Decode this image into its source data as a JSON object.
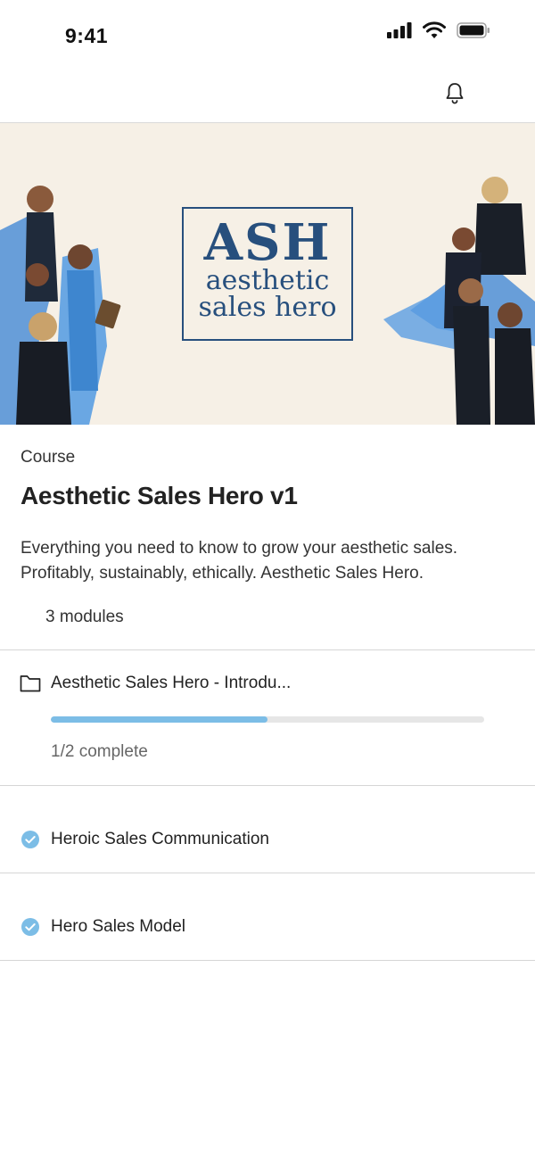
{
  "status_bar": {
    "time": "9:41"
  },
  "hero": {
    "logo_monogram": "ASH",
    "logo_line1": "aesthetic",
    "logo_line2": "sales hero"
  },
  "course": {
    "label": "Course",
    "title": "Aesthetic Sales Hero v1",
    "description": "Everything you need to know to grow your aesthetic sales. Profitably, sustainably, ethically. Aesthetic Sales Hero.",
    "modules_count": "3 modules"
  },
  "modules": [
    {
      "title": "Aesthetic Sales Hero - Introdu...",
      "icon": "folder-icon",
      "progress_text": "1/2 complete",
      "progress_fraction": 0.5
    },
    {
      "title": "Heroic Sales Communication",
      "icon": "check-circle-icon"
    },
    {
      "title": "Hero Sales Model",
      "icon": "check-circle-icon"
    }
  ],
  "colors": {
    "accent": "#7cbde6",
    "logo": "#274f7d",
    "hero_bg": "#f6f0e6"
  }
}
